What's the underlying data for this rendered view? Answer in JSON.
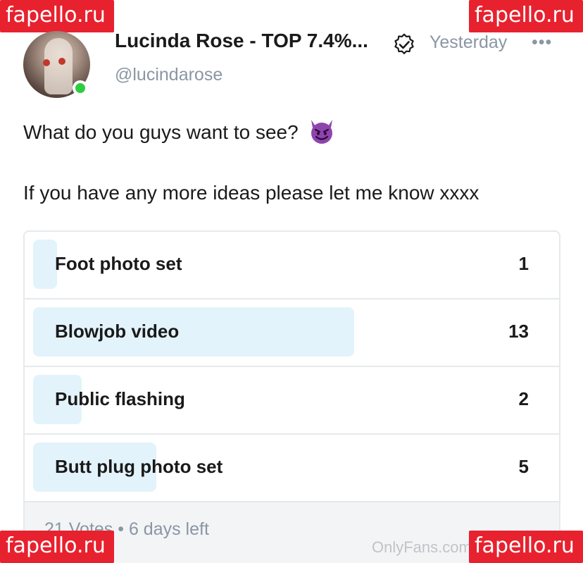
{
  "watermark": {
    "text": "fapello.ru",
    "color": "#e8212e"
  },
  "post": {
    "author_name": "Lucinda Rose - TOP 7.4%...",
    "handle": "@lucindarose",
    "time": "Yesterday",
    "more": "•••",
    "text_line1": "What do you guys want to see?",
    "text_line2": "If you have any more ideas please let me know xxxx"
  },
  "poll": {
    "options": [
      {
        "label": "Foot photo set",
        "count": "1",
        "votes": 1
      },
      {
        "label": "Blowjob video",
        "count": "13",
        "votes": 13
      },
      {
        "label": "Public flashing",
        "count": "2",
        "votes": 2
      },
      {
        "label": "Butt plug photo set",
        "count": "5",
        "votes": 5
      }
    ],
    "footer": "21 Votes • 6 days left",
    "bar_color": "#e3f3fb"
  },
  "footer_watermark": "OnlyFans.com",
  "icons": {
    "verified": "verified-check-icon",
    "emoji": "smiling-devil-emoji-icon",
    "more": "more-dots-icon"
  }
}
